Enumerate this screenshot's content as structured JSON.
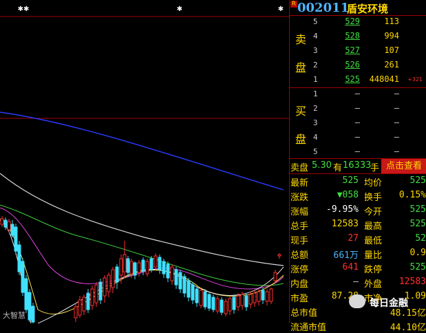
{
  "header": {
    "market_badge": "R",
    "code": "002011",
    "name": "盾安环境"
  },
  "order_book": {
    "sell_label_1": "卖",
    "sell_label_2": "盘",
    "buy_label_1": "买",
    "buy_label_2": "盘",
    "sell": [
      {
        "level": "5",
        "price": "529",
        "volume": "113",
        "change": ""
      },
      {
        "level": "4",
        "price": "528",
        "volume": "994",
        "change": ""
      },
      {
        "level": "3",
        "price": "527",
        "volume": "107",
        "change": ""
      },
      {
        "level": "2",
        "price": "526",
        "volume": "261",
        "change": ""
      },
      {
        "level": "1",
        "price": "525",
        "volume": "448041",
        "change": "+321"
      }
    ],
    "buy": [
      {
        "level": "1",
        "price": "–",
        "volume": "–"
      },
      {
        "level": "2",
        "price": "–",
        "volume": "–"
      },
      {
        "level": "3",
        "price": "–",
        "volume": "–"
      },
      {
        "level": "4",
        "price": "–",
        "volume": "–"
      },
      {
        "level": "5",
        "price": "–",
        "volume": "–"
      }
    ]
  },
  "summary": {
    "label": "卖盘",
    "price": "5.30",
    "mid": "有",
    "qty": "16333",
    "unit": "手",
    "button": "点击查看"
  },
  "quotes": [
    {
      "k1": "最新",
      "v1": "525",
      "c1": "#3fe03f",
      "k2": "均价",
      "v2": "525",
      "c2": "#3fe03f"
    },
    {
      "k1": "涨跌",
      "v1": "▼058",
      "c1": "#3fe03f",
      "k2": "换手",
      "v2": "0.15%",
      "c2": "#ffd700"
    },
    {
      "k1": "涨幅",
      "v1": "-9.95%",
      "c1": "#ffffff",
      "k2": "今开",
      "v2": "525",
      "c2": "#3fe03f"
    },
    {
      "k1": "总手",
      "v1": "12583",
      "c1": "#ffd700",
      "k2": "最高",
      "v2": "525",
      "c2": "#3fe03f"
    },
    {
      "k1": "现手",
      "v1": "27",
      "c1": "#ff3030",
      "k2": "最低",
      "v2": "52",
      "c2": "#3fe03f"
    },
    {
      "k1": "总额",
      "v1": "661万",
      "c1": "#4fb4ff",
      "k2": "量比",
      "v2": "0.9",
      "c2": "#ffd700"
    },
    {
      "k1": "涨停",
      "v1": "641",
      "c1": "#ff3030",
      "k2": "跌停",
      "v2": "525",
      "c2": "#3fe03f"
    },
    {
      "k1": "内盘",
      "v1": "–",
      "c1": "#cccccc",
      "k2": "外盘",
      "v2": "12583",
      "c2": "#ff3030"
    },
    {
      "k1": "市盈",
      "v1": "87.28",
      "c1": "#ffd700",
      "k2": "市净",
      "v2": "1.09",
      "c2": "#ffd700"
    },
    {
      "k1": "总市值",
      "v1": "",
      "c1": "#ffd700",
      "k2": "",
      "v2": "48.15亿",
      "c2": "#ffd700"
    },
    {
      "k1": "流通市值",
      "v1": "",
      "c1": "#ffd700",
      "k2": "",
      "v2": "44.10亿",
      "c2": "#ffd700"
    }
  ],
  "watermark": {
    "text": "每日金融",
    "corner": "大智慧"
  },
  "colors": {
    "up": "#ff3030",
    "down": "#3fe03f",
    "label": "#ffd700",
    "code": "#4fb4ff"
  }
}
